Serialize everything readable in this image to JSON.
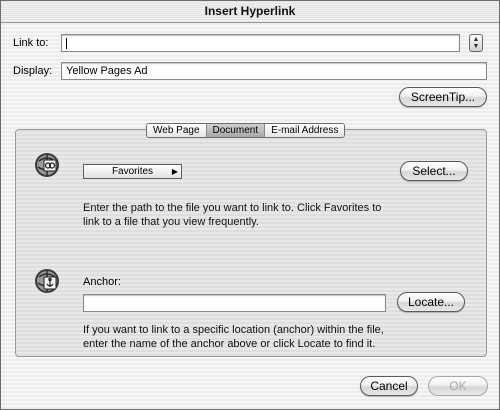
{
  "window": {
    "title": "Insert Hyperlink"
  },
  "form": {
    "link_to_label": "Link to:",
    "link_to_value": "",
    "display_label": "Display:",
    "display_value": "Yellow Pages Ad",
    "screentip_button": "ScreenTip..."
  },
  "tabs": [
    {
      "label": "Web Page",
      "active": false
    },
    {
      "label": "Document",
      "active": true
    },
    {
      "label": "E-mail Address",
      "active": false
    }
  ],
  "document": {
    "favorites_label": "Favorites",
    "select_button": "Select...",
    "path_help_line1": "Enter the path to the file you want to link to. Click Favorites to",
    "path_help_line2": "link to a file that you view frequently.",
    "anchor_label": "Anchor:",
    "anchor_value": "",
    "locate_button": "Locate...",
    "anchor_help_line1": "If you want to link to a specific location (anchor) within the file,",
    "anchor_help_line2": "enter the name of the anchor above or click Locate to find it."
  },
  "footer": {
    "cancel_button": "Cancel",
    "ok_button": "OK"
  },
  "icons": {
    "document_icon": "document-globe-icon",
    "anchor_icon": "anchor-globe-icon"
  }
}
